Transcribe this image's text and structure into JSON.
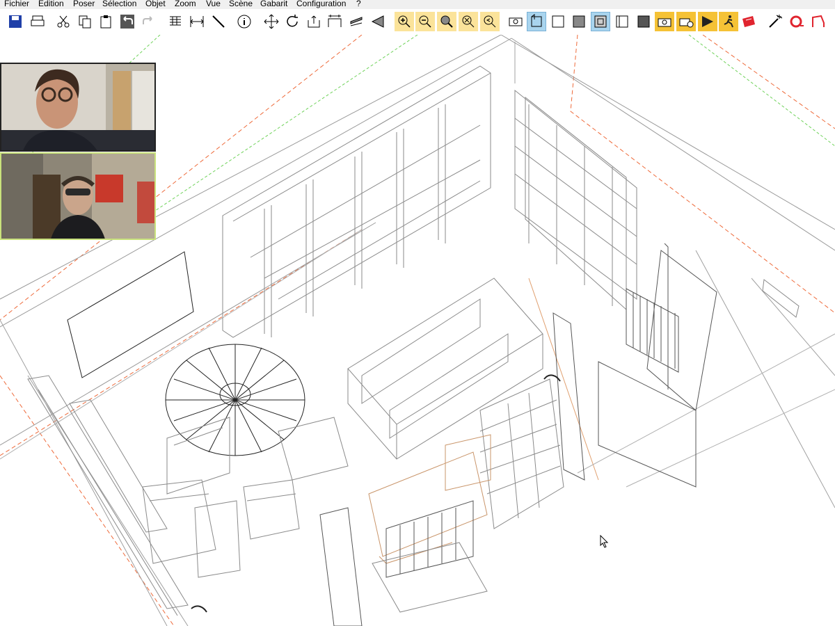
{
  "menu": [
    "Fichier",
    "Edition",
    "Poser",
    "Sélection",
    "Objet",
    "Zoom",
    "Vue",
    "Scène",
    "Gabarit",
    "Configuration",
    "?"
  ],
  "toolbar": [
    {
      "name": "save-icon",
      "style": "plain"
    },
    {
      "name": "print-icon",
      "style": "plain"
    },
    {
      "name": "cut-icon",
      "style": "plain"
    },
    {
      "name": "copy-icon",
      "style": "plain"
    },
    {
      "name": "paste-icon",
      "style": "plain"
    },
    {
      "name": "undo-icon",
      "style": "plain"
    },
    {
      "name": "redo-icon",
      "style": "plain"
    },
    {
      "name": "layer-stack-icon",
      "style": "plain"
    },
    {
      "name": "dimension-icon",
      "style": "plain"
    },
    {
      "name": "line-tool-icon",
      "style": "plain"
    },
    {
      "name": "info-icon",
      "style": "plain"
    },
    {
      "name": "move-icon",
      "style": "plain"
    },
    {
      "name": "rotate-icon",
      "style": "plain"
    },
    {
      "name": "export-icon",
      "style": "plain"
    },
    {
      "name": "stretch-icon",
      "style": "plain"
    },
    {
      "name": "align-icon",
      "style": "plain"
    },
    {
      "name": "mirror-icon",
      "style": "plain"
    },
    {
      "name": "zoom-in-icon",
      "style": "zoom"
    },
    {
      "name": "zoom-out-icon",
      "style": "zoom"
    },
    {
      "name": "zoom-window-icon",
      "style": "zoom"
    },
    {
      "name": "zoom-all-icon",
      "style": "zoom"
    },
    {
      "name": "zoom-previous-icon",
      "style": "zoom"
    },
    {
      "name": "view-camera-icon",
      "style": "plain"
    },
    {
      "name": "view-3d-icon",
      "style": "view"
    },
    {
      "name": "wireframe-icon",
      "style": "plain"
    },
    {
      "name": "solid-icon",
      "style": "plain"
    },
    {
      "name": "view-front-icon",
      "style": "view"
    },
    {
      "name": "view-side-icon",
      "style": "plain"
    },
    {
      "name": "view-shaded-icon",
      "style": "plain"
    },
    {
      "name": "camera-icon",
      "style": "yel"
    },
    {
      "name": "camera-add-icon",
      "style": "yel"
    },
    {
      "name": "render-icon",
      "style": "yel"
    },
    {
      "name": "walk-icon",
      "style": "yel"
    },
    {
      "name": "materials-icon",
      "style": "plain"
    },
    {
      "name": "magic-wand-icon",
      "style": "plain"
    },
    {
      "name": "record-icon",
      "style": "plain"
    },
    {
      "name": "path-tool-icon",
      "style": "plain"
    }
  ],
  "colors": {
    "menubar": "#f0f0f0",
    "zoom_button": "#fbe39a",
    "view_button": "#a9d4ee",
    "yellow_button": "#f5c236",
    "wire": "#8a8a8a",
    "construction_red": "#ee6a3a",
    "construction_green": "#6fd25a"
  }
}
